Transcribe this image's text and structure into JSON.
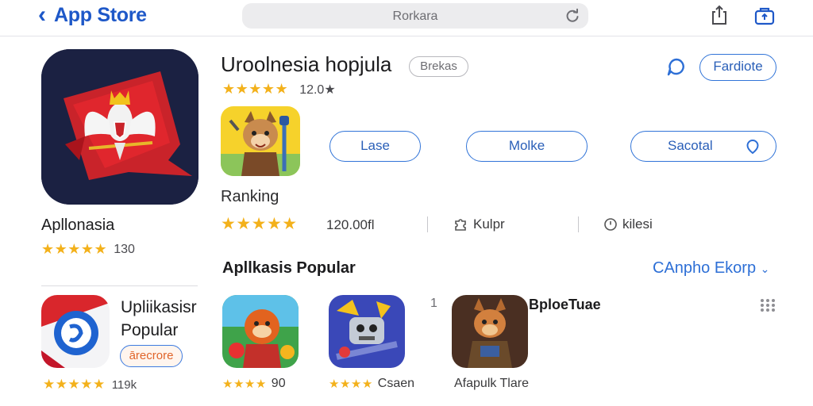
{
  "topbar": {
    "back_label": "App Store",
    "search_text": "Rorkara"
  },
  "hero": {
    "name": "Apllonasia",
    "rating_value": "130",
    "stars": "★★★★★"
  },
  "detail": {
    "title": "Uroolnesia hopjula",
    "badge": "Brekas",
    "rating_stars": "★★★★★",
    "rating_count": "12.0★",
    "favorite_button": "Fardiote",
    "buttons": [
      "Lase",
      "Molke",
      "Sacotal"
    ],
    "ranking_label": "Ranking",
    "ranking_stars": "★★★★★",
    "ranking_value": "120.00fl",
    "meta_1": "Kulpr",
    "meta_2": "kilesi"
  },
  "popular_section": {
    "title": "Apllkasis Popular",
    "link": "CAnpho Ekorp"
  },
  "left_list": {
    "title_line1": "Upliikasisr",
    "title_line2": "Popular",
    "pill": "ārecrore",
    "stars": "★★★★★",
    "rating": "119k"
  },
  "tiles": [
    {
      "stars": "★★★★",
      "caption": "90"
    },
    {
      "stars": "★★★★",
      "caption": "Csaen"
    },
    {
      "caption": "Afapulk Tlare"
    }
  ],
  "tile_name": "BploeTuae",
  "tile_index": "1",
  "colors": {
    "accent": "#2d6fd6",
    "star": "#f3b11b"
  }
}
